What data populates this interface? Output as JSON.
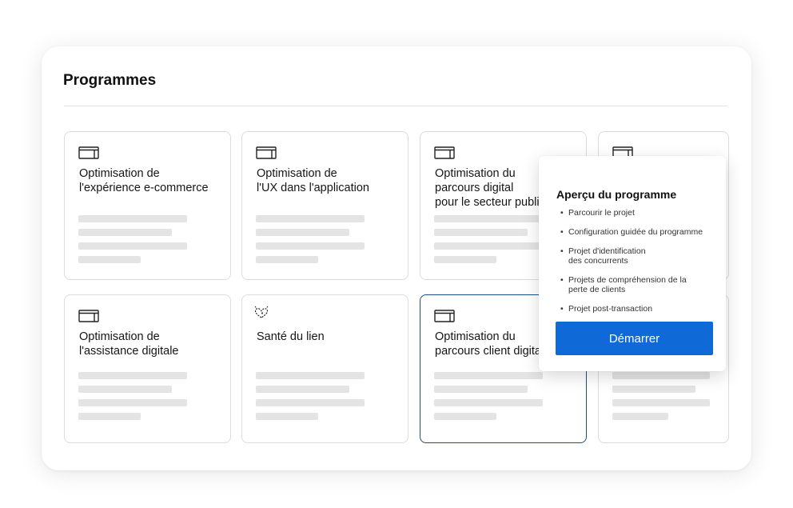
{
  "panel": {
    "title": "Programmes"
  },
  "cards": [
    {
      "title": "Optimisation de\nl'expérience e-commerce",
      "icon": "card-icon"
    },
    {
      "title": "Optimisation de\nl'UX dans l'application",
      "icon": "card-icon"
    },
    {
      "title": "Optimisation du\nparcours digital\npour le secteur public",
      "icon": "card-icon"
    },
    {
      "title": "",
      "icon": "card-icon"
    },
    {
      "title": "Optimisation de\nl'assistance digitale",
      "icon": "card-icon"
    },
    {
      "title": "Santé du lien",
      "icon": "heart-sparkle-icon"
    },
    {
      "title": "Optimisation du\nparcours client digital",
      "icon": "card-icon"
    },
    {
      "title": "",
      "icon": "card-icon"
    }
  ],
  "popover": {
    "title": "Aperçu du programme",
    "items": [
      "Parcourir le projet",
      "Configuration guidée du programme",
      "Projet d'identification\ndes concurrents",
      "Projets de compréhension de la\nperte de clients",
      "Projet post-transaction"
    ],
    "button_label": "Démarrer"
  },
  "colors": {
    "accent": "#0f6ad7",
    "selected_border": "#1d4e89",
    "placeholder_bar": "#e4e4e4"
  }
}
